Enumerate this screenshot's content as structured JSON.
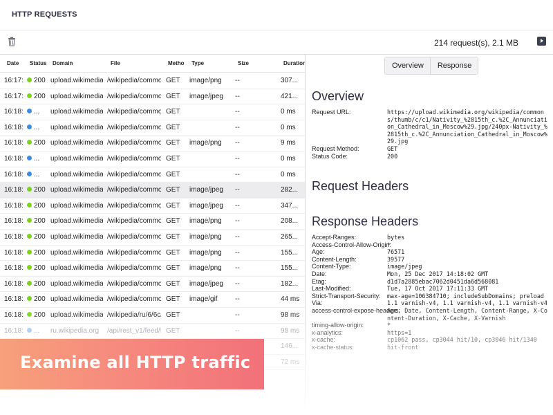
{
  "app": {
    "title": "HTTP REQUESTS"
  },
  "toolbar": {
    "summary": "214 request(s), 2.1 MB"
  },
  "colors": {
    "ok": "#7ed321",
    "pending": "#3b8de0",
    "faded_pending": "#9cc3ee",
    "accent": "#3b3f52"
  },
  "table": {
    "headers": {
      "date": "Date",
      "status": "Status",
      "domain": "Domain",
      "file": "File",
      "method": "Metho",
      "type": "Type",
      "size": "Size",
      "duration": "Duration"
    },
    "rows": [
      {
        "date": "16:17:",
        "dot": "ok",
        "status": "200",
        "domain": "upload.wikimedia.c",
        "file": "/wikipedia/commor",
        "method": "GET",
        "type": "image/png",
        "size": "--",
        "duration": "307..."
      },
      {
        "date": "16:17:",
        "dot": "ok",
        "status": "200",
        "domain": "upload.wikimedia.c",
        "file": "/wikipedia/commor",
        "method": "GET",
        "type": "image/jpeg",
        "size": "--",
        "duration": "421..."
      },
      {
        "date": "16:18:",
        "dot": "pending",
        "status": "...",
        "domain": "upload.wikimedia.c",
        "file": "/wikipedia/commor",
        "method": "GET",
        "type": "",
        "size": "--",
        "duration": "0 ms"
      },
      {
        "date": "16:18:",
        "dot": "pending",
        "status": "...",
        "domain": "upload.wikimedia.c",
        "file": "/wikipedia/commor",
        "method": "GET",
        "type": "",
        "size": "--",
        "duration": "0 ms"
      },
      {
        "date": "16:18:",
        "dot": "ok",
        "status": "200",
        "domain": "upload.wikimedia.c",
        "file": "/wikipedia/commor",
        "method": "GET",
        "type": "image/png",
        "size": "--",
        "duration": "9 ms"
      },
      {
        "date": "16:18:",
        "dot": "pending",
        "status": "...",
        "domain": "upload.wikimedia.c",
        "file": "/wikipedia/commor",
        "method": "GET",
        "type": "",
        "size": "--",
        "duration": "0 ms"
      },
      {
        "date": "16:18:",
        "dot": "pending",
        "status": "...",
        "domain": "upload.wikimedia.c",
        "file": "/wikipedia/commor",
        "method": "GET",
        "type": "",
        "size": "--",
        "duration": "0 ms"
      },
      {
        "date": "16:18:",
        "dot": "ok",
        "status": "200",
        "domain": "upload.wikimedia.c",
        "file": "/wikipedia/commor",
        "method": "GET",
        "type": "image/jpeg",
        "size": "--",
        "duration": "282...",
        "selected": true
      },
      {
        "date": "16:18:",
        "dot": "ok",
        "status": "200",
        "domain": "upload.wikimedia.c",
        "file": "/wikipedia/commor",
        "method": "GET",
        "type": "image/jpeg",
        "size": "--",
        "duration": "347..."
      },
      {
        "date": "16:18:",
        "dot": "ok",
        "status": "200",
        "domain": "upload.wikimedia.c",
        "file": "/wikipedia/commor",
        "method": "GET",
        "type": "image/png",
        "size": "--",
        "duration": "208..."
      },
      {
        "date": "16:18:",
        "dot": "ok",
        "status": "200",
        "domain": "upload.wikimedia.c",
        "file": "/wikipedia/commor",
        "method": "GET",
        "type": "image/png",
        "size": "--",
        "duration": "265..."
      },
      {
        "date": "16:18:",
        "dot": "ok",
        "status": "200",
        "domain": "upload.wikimedia.c",
        "file": "/wikipedia/commor",
        "method": "GET",
        "type": "image/png",
        "size": "--",
        "duration": "155..."
      },
      {
        "date": "16:18:",
        "dot": "ok",
        "status": "200",
        "domain": "upload.wikimedia.c",
        "file": "/wikipedia/commor",
        "method": "GET",
        "type": "image/png",
        "size": "--",
        "duration": "155..."
      },
      {
        "date": "16:18:",
        "dot": "ok",
        "status": "200",
        "domain": "upload.wikimedia.c",
        "file": "/wikipedia/commor",
        "method": "GET",
        "type": "image/jpeg",
        "size": "--",
        "duration": "182..."
      },
      {
        "date": "16:18:",
        "dot": "ok",
        "status": "200",
        "domain": "upload.wikimedia.c",
        "file": "/wikipedia/commor",
        "method": "GET",
        "type": "image/gif",
        "size": "--",
        "duration": "44 ms"
      },
      {
        "date": "16:18:",
        "dot": "ok",
        "status": "200",
        "domain": "upload.wikimedia.c",
        "file": "/wikipedia/ru/6/6c/",
        "method": "GET",
        "type": "",
        "size": "--",
        "duration": "98 ms"
      },
      {
        "date": "16:18:",
        "dot": "faded_pending",
        "status": "...",
        "domain": "ru.wikipedia.org",
        "file": "/api/rest_v1/feed/fe",
        "method": "GET",
        "type": "",
        "size": "--",
        "duration": "98 ms",
        "faded": true
      },
      {
        "date": "",
        "dot": "",
        "status": "",
        "domain": "",
        "file": "",
        "method": "",
        "type": "",
        "size": "",
        "duration": "146...",
        "faded": true
      },
      {
        "date": "",
        "dot": "",
        "status": "",
        "domain": "",
        "file": "",
        "method": "",
        "type": "",
        "size": "",
        "duration": "72 ms",
        "faded": true
      }
    ]
  },
  "details": {
    "tabs": [
      "Overview",
      "Response"
    ],
    "overview": {
      "title": "Overview",
      "url_label": "Request URL:",
      "url_value": "https://upload.wikimedia.org/wikipedia/commons/thumb/c/c1/Nativity_%2815th_c.%2C_Annunciation_Cathedral_in_Moscow%29.jpg/240px-Nativity_%2815th_c.%2C_Annunciation_Cathedral_in_Moscow%29.jpg",
      "method_label": "Request Method:",
      "method_value": "GET",
      "status_label": "Status Code:",
      "status_value": "200"
    },
    "request_headers": {
      "title": "Request Headers"
    },
    "response_headers": {
      "title": "Response Headers",
      "items": [
        {
          "key": "Accept-Ranges:",
          "value": "bytes"
        },
        {
          "key": "Access-Control-Allow-Origin:",
          "value": "*"
        },
        {
          "key": "Age:",
          "value": "76571"
        },
        {
          "key": "Content-Length:",
          "value": "39577"
        },
        {
          "key": "Content-Type:",
          "value": "image/jpeg"
        },
        {
          "key": "Date:",
          "value": "Mon, 25 Dec 2017 14:18:02 GMT"
        },
        {
          "key": "Etag:",
          "value": "d1d7a2885ebac7062d0451da6d568081"
        },
        {
          "key": "Last-Modified:",
          "value": "Tue, 17 Oct 2017 17:11:33 GMT"
        },
        {
          "key": "Strict-Transport-Security:",
          "value": "max-age=106384710; includeSubDomains; preload"
        },
        {
          "key": "Via:",
          "value": "1.1 varnish-v4, 1.1 varnish-v4, 1.1 varnish-v4"
        },
        {
          "key": "access-control-expose-headers:",
          "value": "Age, Date, Content-Length, Content-Range, X-Content-Duration, X-Cache, X-Varnish"
        },
        {
          "key": "timing-allow-origin:",
          "value": "*"
        },
        {
          "key": "x-analytics:",
          "value": "https=1"
        },
        {
          "key": "x-cache:",
          "value": "cp1062 pass, cp3044 hit/10, cp3046 hit/1340"
        },
        {
          "key": "x-cache-status:",
          "value": "hit-front"
        }
      ]
    }
  },
  "banner": {
    "text": "Examine all HTTP traffic"
  }
}
